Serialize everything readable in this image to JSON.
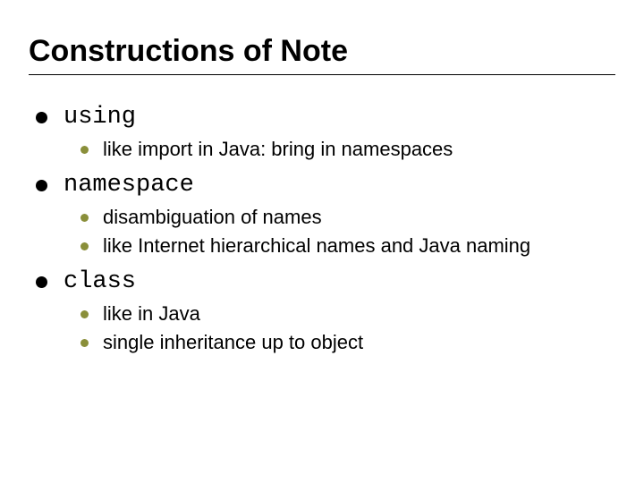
{
  "slide": {
    "title": "Constructions of Note",
    "items": [
      {
        "label": "using",
        "subs": [
          "like import in Java: bring in namespaces"
        ]
      },
      {
        "label": "namespace",
        "subs": [
          "disambiguation of names",
          "like Internet hierarchical names and Java naming"
        ]
      },
      {
        "label": "class",
        "subs": [
          "like in Java",
          "single inheritance up to object"
        ]
      }
    ]
  }
}
